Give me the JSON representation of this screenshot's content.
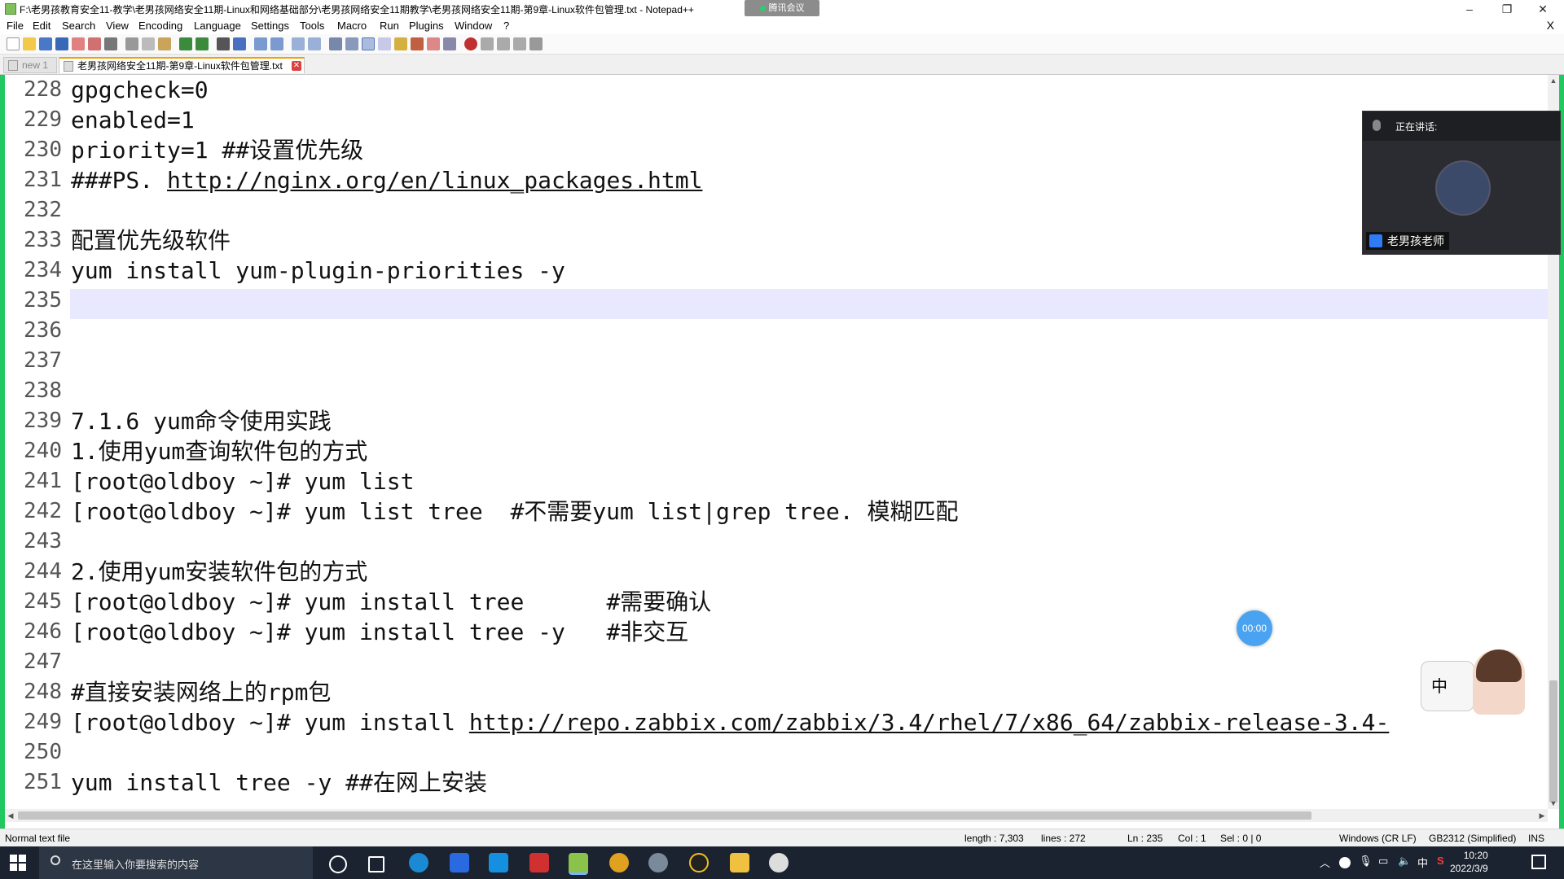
{
  "window": {
    "title": "F:\\老男孩教育安全11-教学\\老男孩网络安全11期-Linux和网络基础部分\\老男孩网络安全11期教学\\老男孩网络安全11期-第9章-Linux软件包管理.txt - Notepad++",
    "meeting_badge": "腾讯会议",
    "minimize": "–",
    "maximize": "❐",
    "close": "✕"
  },
  "menu": {
    "items": [
      "File",
      "Edit",
      "Search",
      "View",
      "Encoding",
      "Language",
      "Settings",
      "Tools",
      "Macro",
      "Run",
      "Plugins",
      "Window",
      "?"
    ],
    "close_x": "X"
  },
  "tabs": [
    {
      "label": "new 1"
    },
    {
      "label": "老男孩网络安全11期-第9章-Linux软件包管理.txt"
    }
  ],
  "editor": {
    "lines": [
      {
        "num": "228",
        "text": "gpgcheck=0"
      },
      {
        "num": "229",
        "text": "enabled=1"
      },
      {
        "num": "230",
        "text": "priority=1 ##设置优先级"
      },
      {
        "num": "231",
        "prefix": "###PS. ",
        "link": "http://nginx.org/en/linux_packages.html"
      },
      {
        "num": "232",
        "text": ""
      },
      {
        "num": "233",
        "text": "配置优先级软件"
      },
      {
        "num": "234",
        "text": "yum install yum-plugin-priorities -y"
      },
      {
        "num": "235",
        "text": ""
      },
      {
        "num": "236",
        "text": ""
      },
      {
        "num": "237",
        "text": ""
      },
      {
        "num": "238",
        "text": ""
      },
      {
        "num": "239",
        "text": "7.1.6 yum命令使用实践"
      },
      {
        "num": "240",
        "text": "1.使用yum查询软件包的方式"
      },
      {
        "num": "241",
        "text": "[root@oldboy ~]# yum list"
      },
      {
        "num": "242",
        "text": "[root@oldboy ~]# yum list tree  #不需要yum list|grep tree. 模糊匹配"
      },
      {
        "num": "243",
        "text": ""
      },
      {
        "num": "244",
        "text": "2.使用yum安装软件包的方式"
      },
      {
        "num": "245",
        "text": "[root@oldboy ~]# yum install tree      #需要确认"
      },
      {
        "num": "246",
        "text": "[root@oldboy ~]# yum install tree -y   #非交互"
      },
      {
        "num": "247",
        "text": ""
      },
      {
        "num": "248",
        "text": "#直接安装网络上的rpm包"
      },
      {
        "num": "249",
        "prefix": "[root@oldboy ~]# yum install ",
        "link": "http://repo.zabbix.com/zabbix/3.4/rhel/7/x86_64/zabbix-release-3.4-"
      },
      {
        "num": "250",
        "text": ""
      },
      {
        "num": "251",
        "text": "yum install tree -y ##在网上安装"
      }
    ]
  },
  "status": {
    "file_type": "Normal text file",
    "length": "length : 7,303",
    "lines": "lines : 272",
    "ln": "Ln : 235",
    "col": "Col : 1",
    "sel": "Sel : 0 | 0",
    "eol": "Windows (CR LF)",
    "encoding": "GB2312 (Simplified)",
    "mode": "INS"
  },
  "meeting": {
    "speaking_label": "正在讲话:",
    "speaker_name": "老男孩老师"
  },
  "timer": "00:00",
  "ime": {
    "label": "中"
  },
  "taskbar": {
    "search_placeholder": "在这里输入你要搜索的内容",
    "ime_indicator": "中",
    "time": "10:20",
    "date": "2022/3/9"
  },
  "colors": {
    "frame": "#21c860",
    "current_line": "#e8e8ff",
    "taskbar": "#1b2330",
    "tab_accent": "#f5a000"
  }
}
